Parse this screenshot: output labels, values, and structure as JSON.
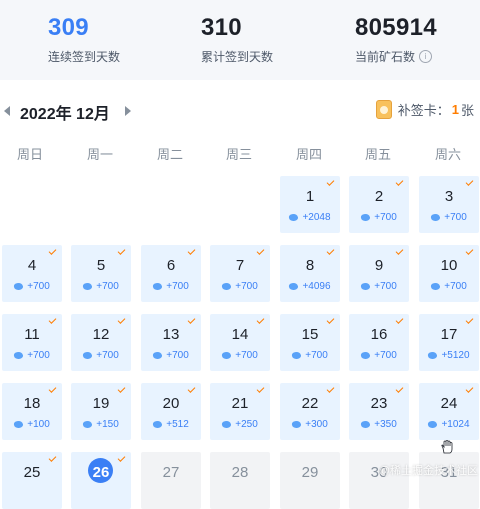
{
  "stats": [
    {
      "value": "309",
      "label": "连续签到天数",
      "highlight": true
    },
    {
      "value": "310",
      "label": "累计签到天数",
      "highlight": false
    },
    {
      "value": "805914",
      "label": "当前矿石数",
      "info": true
    }
  ],
  "month": {
    "title": "2022年 12月"
  },
  "makeup": {
    "label": "补签卡：",
    "count": "1",
    "unit": "张"
  },
  "weekdays": [
    "周日",
    "周一",
    "周二",
    "周三",
    "周四",
    "周五",
    "周六"
  ],
  "info_icon_glyph": "i",
  "days": [
    {
      "day": "1",
      "reward": "+2048",
      "checked": true
    },
    {
      "day": "2",
      "reward": "+700",
      "checked": true
    },
    {
      "day": "3",
      "reward": "+700",
      "checked": true
    },
    {
      "day": "4",
      "reward": "+700",
      "checked": true
    },
    {
      "day": "5",
      "reward": "+700",
      "checked": true
    },
    {
      "day": "6",
      "reward": "+700",
      "checked": true
    },
    {
      "day": "7",
      "reward": "+700",
      "checked": true
    },
    {
      "day": "8",
      "reward": "+4096",
      "checked": true
    },
    {
      "day": "9",
      "reward": "+700",
      "checked": true
    },
    {
      "day": "10",
      "reward": "+700",
      "checked": true
    },
    {
      "day": "11",
      "reward": "+700",
      "checked": true
    },
    {
      "day": "12",
      "reward": "+700",
      "checked": true
    },
    {
      "day": "13",
      "reward": "+700",
      "checked": true
    },
    {
      "day": "14",
      "reward": "+700",
      "checked": true
    },
    {
      "day": "15",
      "reward": "+700",
      "checked": true
    },
    {
      "day": "16",
      "reward": "+700",
      "checked": true
    },
    {
      "day": "17",
      "reward": "+5120",
      "checked": true
    },
    {
      "day": "18",
      "reward": "+100",
      "checked": true
    },
    {
      "day": "19",
      "reward": "+150",
      "checked": true
    },
    {
      "day": "20",
      "reward": "+512",
      "checked": true
    },
    {
      "day": "21",
      "reward": "+250",
      "checked": true
    },
    {
      "day": "22",
      "reward": "+300",
      "checked": true
    },
    {
      "day": "23",
      "reward": "+350",
      "checked": true
    },
    {
      "day": "24",
      "reward": "+1024",
      "checked": true
    },
    {
      "day": "25",
      "reward": "",
      "checked": true
    },
    {
      "day": "26",
      "reward": "",
      "checked": true,
      "today": true
    },
    {
      "day": "27",
      "reward": "",
      "checked": false,
      "future": true
    },
    {
      "day": "28",
      "reward": "",
      "checked": false,
      "future": true
    },
    {
      "day": "29",
      "reward": "",
      "checked": false,
      "future": true
    },
    {
      "day": "30",
      "reward": "",
      "checked": false,
      "future": true
    },
    {
      "day": "31",
      "reward": "",
      "checked": false,
      "future": true
    }
  ],
  "watermark": "@稀土掘金技术社区",
  "colors": {
    "primary": "#3a7ff5",
    "checked": "#ff7d00",
    "cell": "#e8f3ff"
  }
}
